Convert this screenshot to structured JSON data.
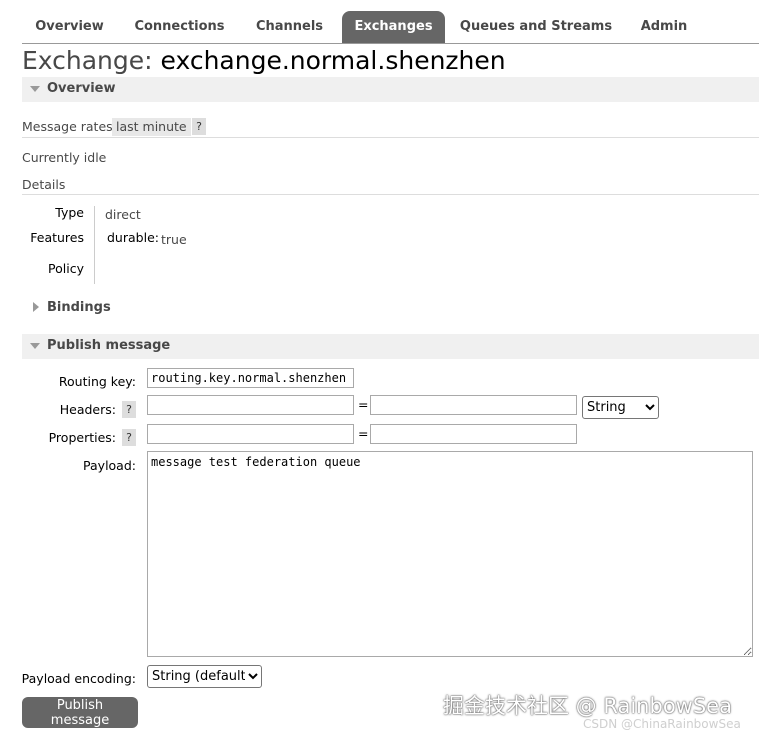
{
  "nav": {
    "tabs": [
      {
        "label": "Overview"
      },
      {
        "label": "Connections"
      },
      {
        "label": "Channels"
      },
      {
        "label": "Exchanges",
        "active": true
      },
      {
        "label": "Queues and Streams"
      },
      {
        "label": "Admin"
      }
    ]
  },
  "page": {
    "title_prefix": "Exchange: ",
    "title_name": "exchange.normal.shenzhen"
  },
  "overview": {
    "header": "Overview",
    "rates_label": "Message rates",
    "rates_value": "last minute",
    "help": "?",
    "idle": "Currently idle",
    "details_label": "Details",
    "type_label": "Type",
    "type_value": "direct",
    "features_label": "Features",
    "durable_key": "durable:",
    "durable_value": "true",
    "policy_label": "Policy"
  },
  "bindings": {
    "header": "Bindings"
  },
  "publish": {
    "header": "Publish message",
    "routing_key_label": "Routing key:",
    "routing_key_value": "routing.key.normal.shenzhen",
    "headers_label": "Headers:",
    "properties_label": "Properties:",
    "help": "?",
    "equals": "=",
    "header_type_selected": "String",
    "payload_label": "Payload:",
    "payload_value": "message test federation queue",
    "encoding_label": "Payload encoding:",
    "encoding_selected": "String (default)",
    "publish_button": "Publish message"
  },
  "watermark": {
    "main": "掘金技术社区 @ RainbowSea",
    "sub": "CSDN @ChinaRainbowSea"
  }
}
